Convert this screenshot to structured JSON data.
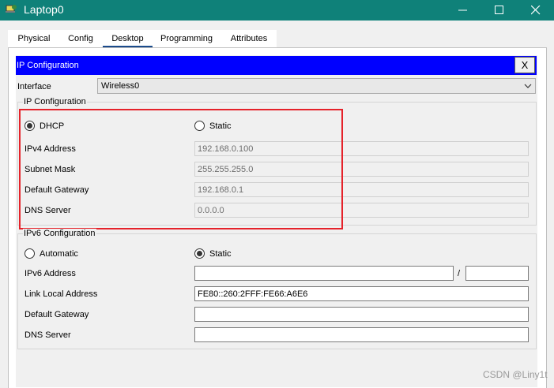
{
  "window": {
    "title": "Laptop0"
  },
  "tabs": [
    "Physical",
    "Config",
    "Desktop",
    "Programming",
    "Attributes"
  ],
  "active_tab": "Desktop",
  "panel": {
    "title": "IP Configuration",
    "close_label": "X"
  },
  "interface": {
    "label": "Interface",
    "value": "Wireless0"
  },
  "ipv4": {
    "group_title": "IP Configuration",
    "dhcp_label": "DHCP",
    "static_label": "Static",
    "selected": "DHCP",
    "ip_label": "IPv4 Address",
    "ip_value": "192.168.0.100",
    "mask_label": "Subnet Mask",
    "mask_value": "255.255.255.0",
    "gateway_label": "Default Gateway",
    "gateway_value": "192.168.0.1",
    "dns_label": "DNS Server",
    "dns_value": "0.0.0.0"
  },
  "ipv6": {
    "group_title": "IPv6 Configuration",
    "auto_label": "Automatic",
    "static_label": "Static",
    "selected": "Static",
    "addr_label": "IPv6 Address",
    "addr_value": "",
    "prefix_sep": "/",
    "prefix_value": "",
    "link_local_label": "Link Local Address",
    "link_local_value": "FE80::260:2FFF:FE66:A6E6",
    "gateway_label": "Default Gateway",
    "gateway_value": "",
    "dns_label": "DNS Server",
    "dns_value": ""
  },
  "watermark": "CSDN @Liny1t",
  "colors": {
    "titlebar": "#0f8179",
    "panel_header": "#0000ff",
    "highlight_box": "#e5222a"
  }
}
